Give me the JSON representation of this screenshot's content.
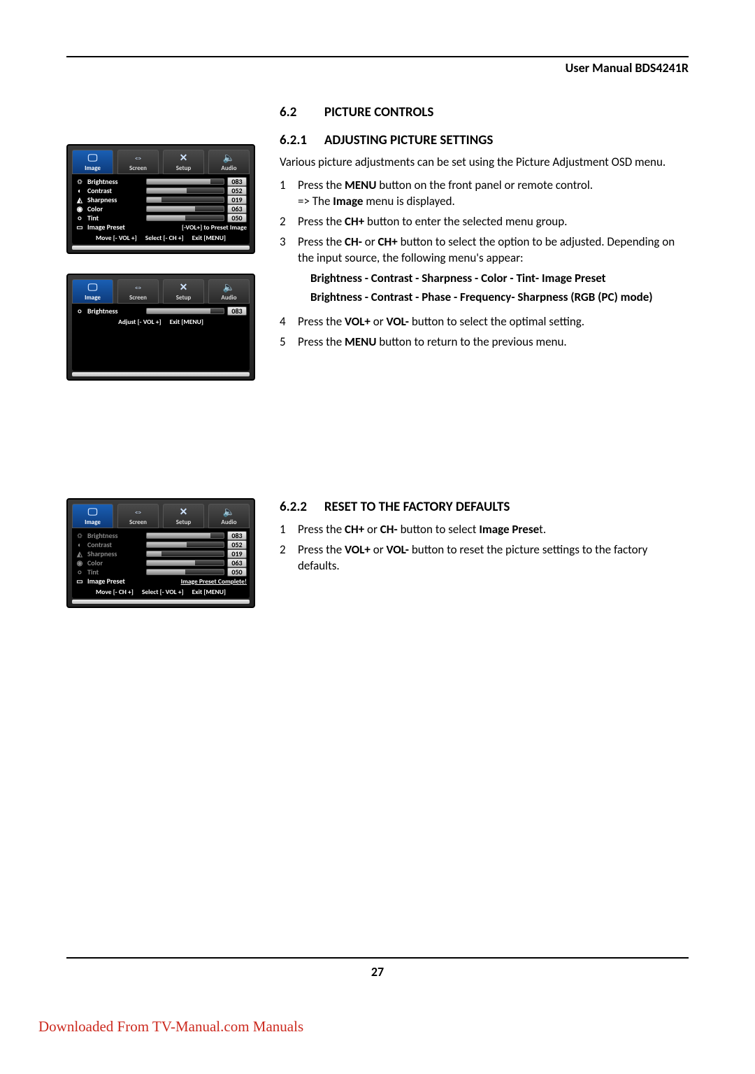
{
  "header": {
    "title": "User Manual BDS4241R"
  },
  "page_number": "27",
  "download_text": "Downloaded From TV-Manual.com Manuals",
  "osd_tabs": [
    {
      "label": "Image",
      "icon": "🖵"
    },
    {
      "label": "Screen",
      "icon": "⇔"
    },
    {
      "label": "Setup",
      "icon": "✕"
    },
    {
      "label": "Audio",
      "icon": "🔈"
    }
  ],
  "osd1": {
    "rows": [
      {
        "icon": "☼",
        "label": "Brightness",
        "value": "083",
        "pct": 83,
        "active": true
      },
      {
        "icon": "◐",
        "label": "Contrast",
        "value": "052",
        "pct": 52,
        "active": true
      },
      {
        "icon": "◭",
        "label": "Sharpness",
        "value": "019",
        "pct": 19,
        "active": true
      },
      {
        "icon": "◉",
        "label": "Color",
        "value": "063",
        "pct": 63,
        "active": true
      },
      {
        "icon": "○",
        "label": "Tint",
        "value": "050",
        "pct": 50,
        "active": true
      }
    ],
    "preset_row": {
      "label": "Image Preset",
      "right": "[-VOL+] to Preset Image"
    },
    "hints": [
      "Move [- VOL +]",
      "Select [- CH +]",
      "Exit [MENU]"
    ]
  },
  "osd2": {
    "row": {
      "icon": "○",
      "label": "Brightness",
      "value": "083",
      "pct": 83
    },
    "hints": [
      "Adjust [- VOL +]",
      "Exit [MENU]"
    ]
  },
  "osd3": {
    "rows": [
      {
        "icon": "☼",
        "label": "Brightness",
        "value": "083",
        "pct": 83,
        "active": false
      },
      {
        "icon": "◐",
        "label": "Contrast",
        "value": "052",
        "pct": 52,
        "active": false
      },
      {
        "icon": "◭",
        "label": "Sharpness",
        "value": "019",
        "pct": 19,
        "active": false
      },
      {
        "icon": "◉",
        "label": "Color",
        "value": "063",
        "pct": 63,
        "active": false
      },
      {
        "icon": "○",
        "label": "Tint",
        "value": "050",
        "pct": 50,
        "active": false
      }
    ],
    "preset_row": {
      "label": "Image Preset",
      "right": "Image Preset Complete!"
    },
    "hints": [
      "Move [- CH +]",
      "Select [- VOL +]",
      "Exit [MENU]"
    ]
  },
  "section62": {
    "num": "6.2",
    "title": "PICTURE CONTROLS"
  },
  "section621": {
    "num": "6.2.1",
    "title": "ADJUSTING PICTURE SETTINGS",
    "intro": "Various picture adjustments can be set using the Picture Adjustment OSD menu.",
    "step1a": "Press the ",
    "step1b": "MENU",
    "step1c": " button on the front panel or remote control.",
    "step1d": "=> The ",
    "step1e": "Image",
    "step1f": " menu is displayed.",
    "step2a": "Press the ",
    "step2b": "CH+",
    "step2c": " button to enter the selected menu group.",
    "step3a": "Press the ",
    "step3b": "CH-",
    "step3c": " or ",
    "step3d": "CH+",
    "step3e": " button to select the option to be adjusted. Depending on the input source, the following menu's appear:",
    "bullet1a": "Brightness - Contrast - Sharpness - Color - Tint",
    "bullet1b": "- Image Preset",
    "bullet2a": "Brightness - Contrast - Phase - Frequency",
    "bullet2b": "- Sharpness (RGB (PC) mode)",
    "step4a": "Press the ",
    "step4b": "VOL+",
    "step4c": " or ",
    "step4d": "VOL-",
    "step4e": " button to select the optimal setting.",
    "step5a": "Press the ",
    "step5b": "MENU",
    "step5c": " button to return to the previous menu."
  },
  "section622": {
    "num": "6.2.2",
    "title": "RESET TO THE FACTORY DEFAULTS",
    "step1a": "Press the ",
    "step1b": "CH+",
    "step1c": " or ",
    "step1d": "CH-",
    "step1e": " button to select ",
    "step1f": "Image Prese",
    "step1g": "t.",
    "step2a": "Press the ",
    "step2b": "VOL+",
    "step2c": " or ",
    "step2d": "VOL-",
    "step2e": " button to reset the picture settings to the factory defaults."
  }
}
